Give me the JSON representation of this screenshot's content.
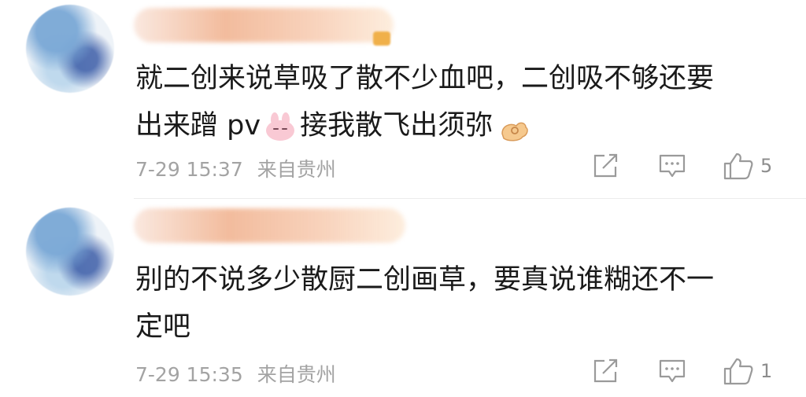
{
  "comments": [
    {
      "content_line1": "就二创来说草吸了散不少血吧，二创吸不够还要",
      "content_line2_a": "出来蹭 pv",
      "content_line2_b": "接我散飞出须弥",
      "time": "7-29 15:37",
      "location": "来自贵州",
      "like_count": "5"
    },
    {
      "content_line1": "别的不说多少散厨二创画草，要真说谁糊还不一",
      "content_line2": "定吧",
      "time": "7-29 15:35",
      "location": "来自贵州",
      "like_count": "1"
    }
  ],
  "icons": {
    "share": "share-icon",
    "reply": "comment-icon",
    "like": "thumbs-up-icon",
    "emoji1": "pink-bunny-emoji",
    "emoji2": "ok-hand-emoji"
  },
  "colors": {
    "text": "#1a1a1a",
    "meta": "#a3a3a3",
    "divider": "#ececec"
  }
}
